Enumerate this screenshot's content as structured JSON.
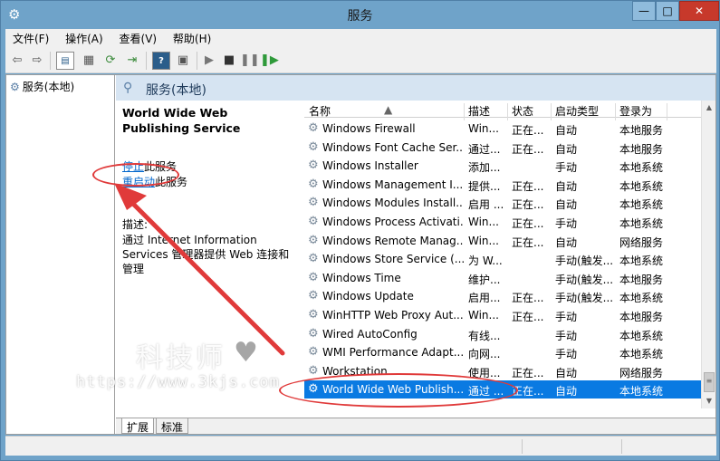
{
  "window": {
    "title": "服务",
    "app_icon": "gear-icon",
    "minimize": "—",
    "maximize": "□",
    "close": "✕"
  },
  "menu": [
    "文件(F)",
    "操作(A)",
    "查看(V)",
    "帮助(H)"
  ],
  "toolbar": {
    "icons": [
      "back-arrow-icon",
      "forward-arrow-icon",
      "show-tree-icon",
      "properties-icon",
      "refresh-icon",
      "export-list-icon",
      "help-icon",
      "show-console-icon",
      "start-service-icon",
      "stop-service-icon",
      "pause-service-icon",
      "resume-service-icon"
    ]
  },
  "tree": {
    "root_label": "服务(本地)"
  },
  "panel": {
    "header": "服务(本地)"
  },
  "detail": {
    "service_name": "World Wide Web Publishing Service",
    "stop_link": "停止",
    "stop_suffix": "此服务",
    "restart_link": "重启动",
    "restart_suffix": "此服务",
    "desc_label": "描述:",
    "desc_text": "通过 Internet Information Services 管理器提供 Web 连接和管理"
  },
  "grid": {
    "columns": [
      "名称",
      "描述",
      "状态",
      "启动类型",
      "登录为"
    ],
    "rows": [
      {
        "name": "Windows Firewall",
        "desc": "Win...",
        "status": "正在...",
        "startup": "自动",
        "logon": "本地服务"
      },
      {
        "name": "Windows Font Cache Ser...",
        "desc": "通过...",
        "status": "正在...",
        "startup": "自动",
        "logon": "本地服务"
      },
      {
        "name": "Windows Installer",
        "desc": "添加...",
        "status": "",
        "startup": "手动",
        "logon": "本地系统"
      },
      {
        "name": "Windows Management I...",
        "desc": "提供...",
        "status": "正在...",
        "startup": "自动",
        "logon": "本地系统"
      },
      {
        "name": "Windows Modules Install...",
        "desc": "启用 ...",
        "status": "正在...",
        "startup": "自动",
        "logon": "本地系统"
      },
      {
        "name": "Windows Process Activati...",
        "desc": "Win...",
        "status": "正在...",
        "startup": "手动",
        "logon": "本地系统"
      },
      {
        "name": "Windows Remote Manag...",
        "desc": "Win...",
        "status": "正在...",
        "startup": "自动",
        "logon": "网络服务"
      },
      {
        "name": "Windows Store Service (...",
        "desc": "为 W...",
        "status": "",
        "startup": "手动(触发...",
        "logon": "本地系统"
      },
      {
        "name": "Windows Time",
        "desc": "维护...",
        "status": "",
        "startup": "手动(触发...",
        "logon": "本地服务"
      },
      {
        "name": "Windows Update",
        "desc": "启用...",
        "status": "正在...",
        "startup": "手动(触发...",
        "logon": "本地系统"
      },
      {
        "name": "WinHTTP Web Proxy Aut...",
        "desc": "Win...",
        "status": "正在...",
        "startup": "手动",
        "logon": "本地服务"
      },
      {
        "name": "Wired AutoConfig",
        "desc": "有线...",
        "status": "",
        "startup": "手动",
        "logon": "本地系统"
      },
      {
        "name": "WMI Performance Adapt...",
        "desc": "向网...",
        "status": "",
        "startup": "手动",
        "logon": "本地系统"
      },
      {
        "name": "Workstation",
        "desc": "使用...",
        "status": "正在...",
        "startup": "自动",
        "logon": "网络服务"
      },
      {
        "name": "World Wide Web Publish...",
        "desc": "通过 ...",
        "status": "正在...",
        "startup": "自动",
        "logon": "本地系统",
        "selected": true
      }
    ]
  },
  "tabs": [
    "扩展",
    "标准"
  ],
  "watermark": {
    "text": "科技师",
    "url": "https://www.3kjs.com"
  },
  "colors": {
    "accent": "#0a7ae2",
    "annotation": "#e03a3a",
    "titlebar": "#6fa3c9"
  }
}
